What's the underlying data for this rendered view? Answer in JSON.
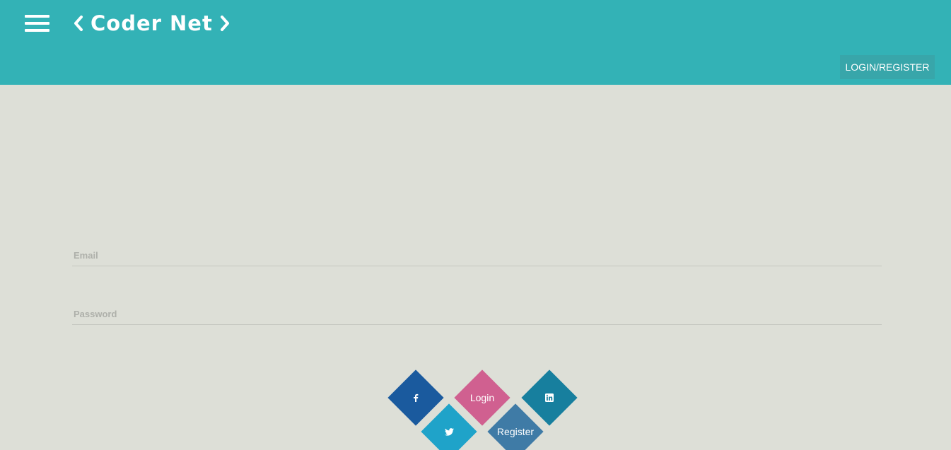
{
  "header": {
    "brand": "Coder Net",
    "login_register": "LOGIN/REGISTER"
  },
  "form": {
    "email_placeholder": "Email",
    "email_value": "",
    "password_placeholder": "Password",
    "password_value": ""
  },
  "actions": {
    "login_label": "Login",
    "register_label": "Register",
    "social": [
      "facebook-icon",
      "twitter-icon",
      "linkedin-icon"
    ]
  },
  "colors": {
    "header": "#33b2b6",
    "background": "#dddfd7",
    "facebook": "#1a5a9e",
    "login": "#d06090",
    "linkedin": "#177f9e",
    "twitter": "#1fa3c9",
    "register": "#3f7ba6"
  }
}
